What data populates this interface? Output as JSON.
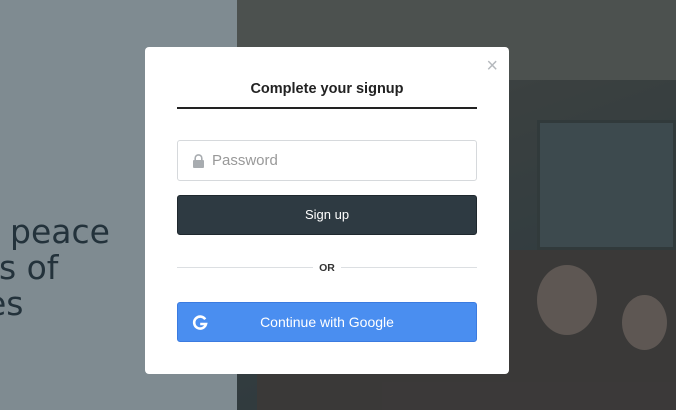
{
  "hero": {
    "lines": [
      "r peace",
      "ts of",
      "es"
    ]
  },
  "modal": {
    "title": "Complete your signup",
    "close_icon": "×",
    "password": {
      "placeholder": "Password",
      "icon": "lock-icon"
    },
    "signup_label": "Sign up",
    "divider_label": "OR",
    "google": {
      "label": "Continue with Google",
      "icon": "google-icon"
    }
  },
  "colors": {
    "dark_button": "#2e3a42",
    "google_button": "#4a8ef0",
    "backdrop": "#7f8b91"
  }
}
